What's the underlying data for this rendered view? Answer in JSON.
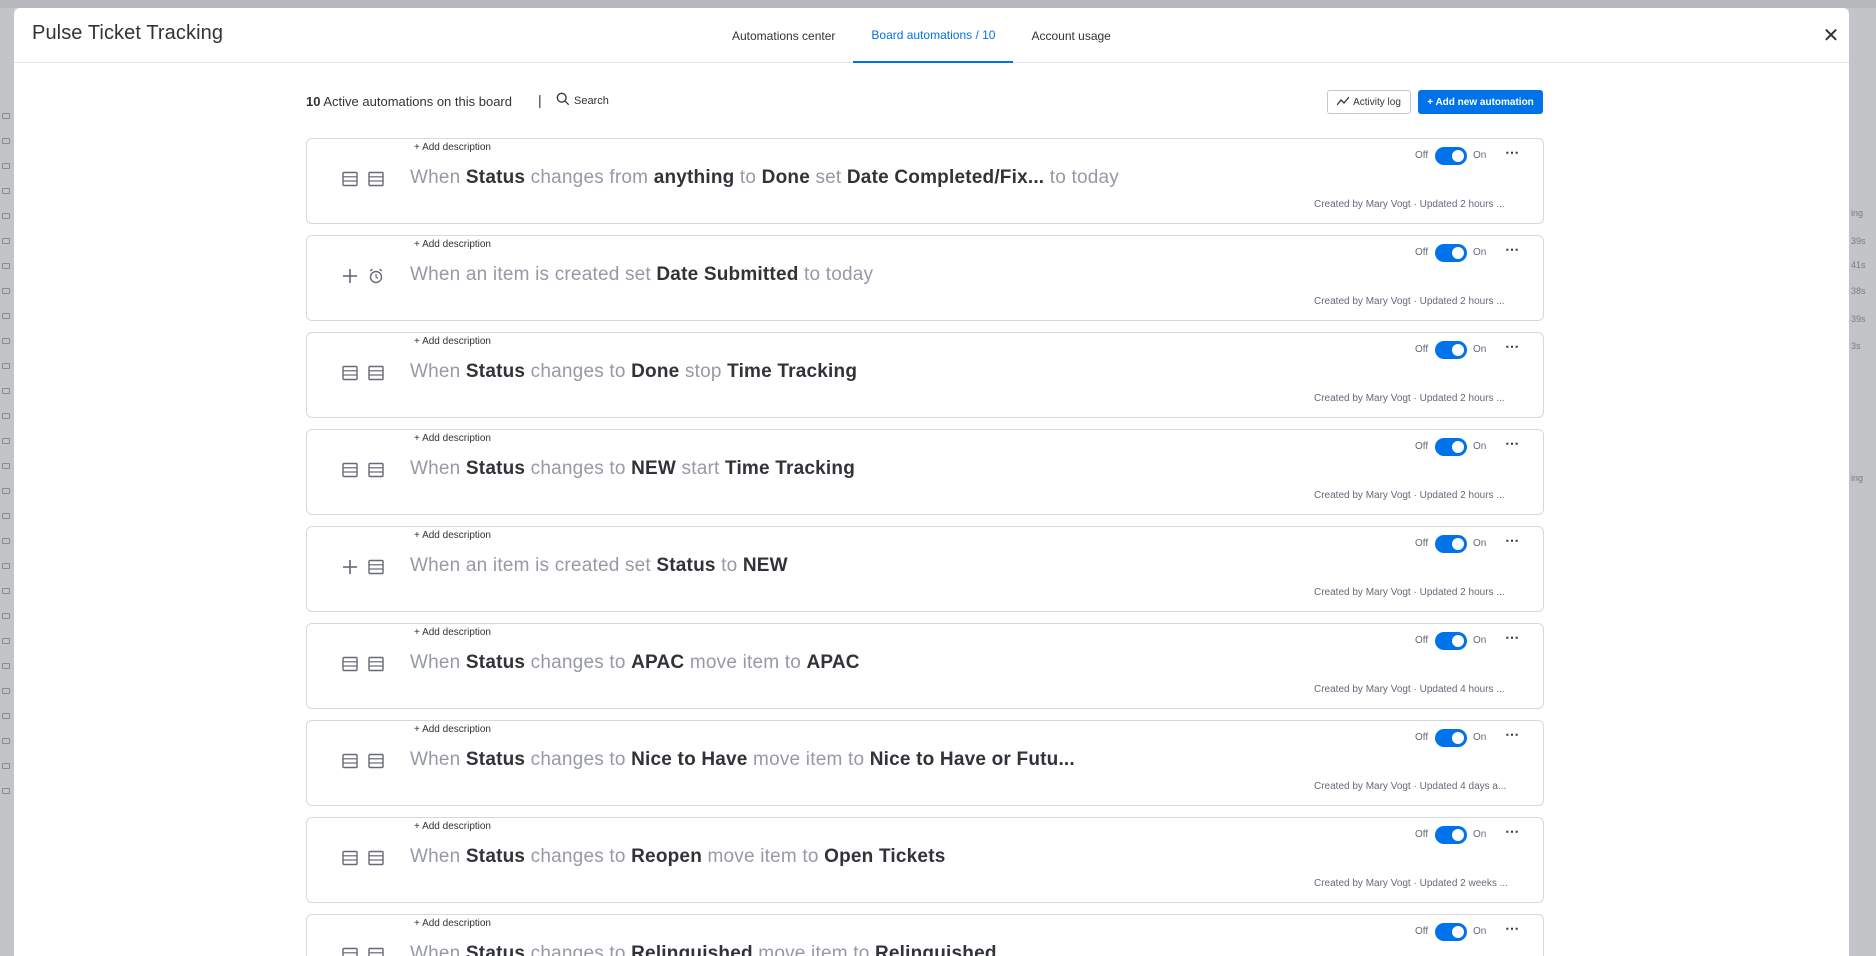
{
  "header": {
    "title": "Pulse Ticket Tracking",
    "tabs": [
      {
        "label": "Automations center",
        "active": false
      },
      {
        "label": "Board automations / 10",
        "active": true
      },
      {
        "label": "Account usage",
        "active": false
      }
    ],
    "close_icon": "close-icon"
  },
  "toolbar": {
    "count": "10",
    "count_suffix": "Active automations on this board",
    "separator": "|",
    "search_label": "Search",
    "activity_log_label": "Activity log",
    "add_label": "+ Add new automation"
  },
  "background_right": [
    "ing",
    "39s",
    "41s",
    "38s",
    "39s",
    "3s",
    "ing"
  ],
  "automations": [
    {
      "add_description": "+ Add description",
      "icons": [
        "table-icon",
        "table-icon"
      ],
      "parts": [
        {
          "t": "When ",
          "k": false
        },
        {
          "t": "Status",
          "k": true
        },
        {
          "t": " changes from ",
          "k": false
        },
        {
          "t": "anything",
          "k": true
        },
        {
          "t": " to ",
          "k": false
        },
        {
          "t": "Done",
          "k": true
        },
        {
          "t": " set ",
          "k": false
        },
        {
          "t": "Date Completed/Fix...",
          "k": true
        },
        {
          "t": "  to today",
          "k": false
        }
      ],
      "off": "Off",
      "on": "On",
      "enabled": true,
      "meta": "Created by Mary Vogt · Updated 2 hours ..."
    },
    {
      "add_description": "+ Add description",
      "icons": [
        "plus-icon",
        "alarm-icon"
      ],
      "parts": [
        {
          "t": "When an item is created set ",
          "k": false
        },
        {
          "t": "Date Submitted",
          "k": true
        },
        {
          "t": " to today",
          "k": false
        }
      ],
      "off": "Off",
      "on": "On",
      "enabled": true,
      "meta": "Created by Mary Vogt · Updated 2 hours ..."
    },
    {
      "add_description": "+ Add description",
      "icons": [
        "table-icon",
        "table-icon"
      ],
      "parts": [
        {
          "t": "When ",
          "k": false
        },
        {
          "t": "Status",
          "k": true
        },
        {
          "t": " changes to ",
          "k": false
        },
        {
          "t": "Done",
          "k": true
        },
        {
          "t": " stop ",
          "k": false
        },
        {
          "t": "Time Tracking",
          "k": true
        }
      ],
      "off": "Off",
      "on": "On",
      "enabled": true,
      "meta": "Created by Mary Vogt · Updated 2 hours ..."
    },
    {
      "add_description": "+ Add description",
      "icons": [
        "table-icon",
        "table-icon"
      ],
      "parts": [
        {
          "t": "When ",
          "k": false
        },
        {
          "t": "Status",
          "k": true
        },
        {
          "t": " changes to ",
          "k": false
        },
        {
          "t": "NEW",
          "k": true
        },
        {
          "t": " start ",
          "k": false
        },
        {
          "t": "Time Tracking",
          "k": true
        }
      ],
      "off": "Off",
      "on": "On",
      "enabled": true,
      "meta": "Created by Mary Vogt · Updated 2 hours ..."
    },
    {
      "add_description": "+ Add description",
      "icons": [
        "plus-icon",
        "table-icon"
      ],
      "parts": [
        {
          "t": "When an item is created set ",
          "k": false
        },
        {
          "t": "Status",
          "k": true
        },
        {
          "t": " to ",
          "k": false
        },
        {
          "t": "NEW",
          "k": true
        }
      ],
      "off": "Off",
      "on": "On",
      "enabled": true,
      "meta": "Created by Mary Vogt · Updated 2 hours ..."
    },
    {
      "add_description": "+ Add description",
      "icons": [
        "table-icon",
        "table-icon"
      ],
      "parts": [
        {
          "t": "When ",
          "k": false
        },
        {
          "t": "Status",
          "k": true
        },
        {
          "t": " changes to ",
          "k": false
        },
        {
          "t": "APAC",
          "k": true
        },
        {
          "t": " move item to ",
          "k": false
        },
        {
          "t": "APAC",
          "k": true
        }
      ],
      "off": "Off",
      "on": "On",
      "enabled": true,
      "meta": "Created by Mary Vogt · Updated 4 hours ..."
    },
    {
      "add_description": "+ Add description",
      "icons": [
        "table-icon",
        "table-icon"
      ],
      "parts": [
        {
          "t": "When ",
          "k": false
        },
        {
          "t": "Status",
          "k": true
        },
        {
          "t": " changes to ",
          "k": false
        },
        {
          "t": "Nice to Have",
          "k": true
        },
        {
          "t": " move item to ",
          "k": false
        },
        {
          "t": "Nice to Have or Futu...",
          "k": true
        }
      ],
      "off": "Off",
      "on": "On",
      "enabled": true,
      "meta": "Created by Mary Vogt · Updated 4 days a..."
    },
    {
      "add_description": "+ Add description",
      "icons": [
        "table-icon",
        "table-icon"
      ],
      "parts": [
        {
          "t": "When ",
          "k": false
        },
        {
          "t": "Status",
          "k": true
        },
        {
          "t": " changes to ",
          "k": false
        },
        {
          "t": "Reopen",
          "k": true
        },
        {
          "t": " move item to ",
          "k": false
        },
        {
          "t": "Open Tickets",
          "k": true
        }
      ],
      "off": "Off",
      "on": "On",
      "enabled": true,
      "meta": "Created by Mary Vogt · Updated 2 weeks ..."
    },
    {
      "add_description": "+ Add description",
      "icons": [
        "table-icon",
        "table-icon"
      ],
      "parts": [
        {
          "t": "When ",
          "k": false
        },
        {
          "t": "Status",
          "k": true
        },
        {
          "t": " changes to ",
          "k": false
        },
        {
          "t": "Relinquished",
          "k": true
        },
        {
          "t": " move item to ",
          "k": false
        },
        {
          "t": "Relinquished",
          "k": true
        }
      ],
      "off": "Off",
      "on": "On",
      "enabled": true,
      "meta": ""
    }
  ]
}
